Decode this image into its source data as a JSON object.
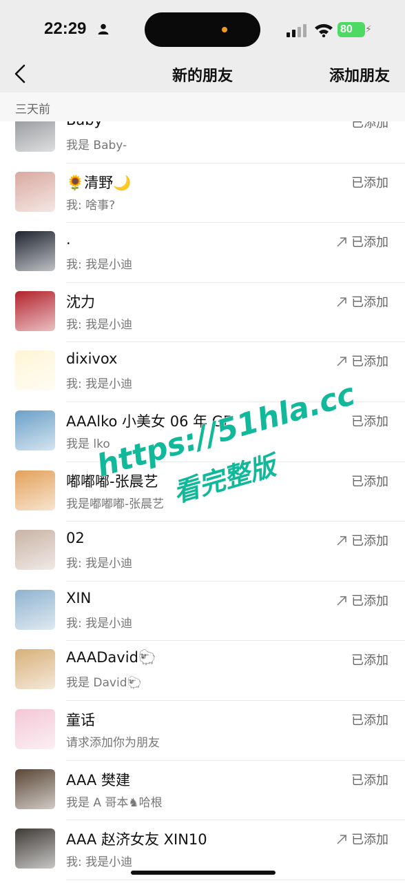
{
  "status_bar": {
    "time": "22:29",
    "battery": "80",
    "icons": [
      "person-icon",
      "signal-icon",
      "wifi-icon",
      "battery-icon"
    ],
    "battery_color": "#4cd964",
    "island_dot_color": "#f39a1e"
  },
  "nav": {
    "back_icon": "chevron-left-icon",
    "title": "新的朋友",
    "add_friend": "添加朋友"
  },
  "section": {
    "label": "三天前"
  },
  "rows": [
    {
      "name": "Baby-",
      "sub": "我是 Baby-",
      "status": "已添加",
      "arrow": false,
      "avatar_color": "#8c8f93"
    },
    {
      "name": "🌻清野🌙",
      "sub": "我: 啥事?",
      "status": "已添加",
      "arrow": false,
      "avatar_color": "#d9a9a0"
    },
    {
      "name": ".",
      "sub": "我: 我是小迪",
      "status": "已添加",
      "arrow": true,
      "avatar_color": "#1f2430"
    },
    {
      "name": "沈力",
      "sub": "我: 我是小迪",
      "status": "已添加",
      "arrow": true,
      "avatar_color": "#b3222c"
    },
    {
      "name": "dixivox",
      "sub": "我: 我是小迪",
      "status": "已添加",
      "arrow": true,
      "avatar_color": "#fff5d6"
    },
    {
      "name": "AAAlko 小美女 06 年 GF",
      "sub": "我是 lko",
      "status": "已添加",
      "arrow": false,
      "avatar_color": "#6aa0c8"
    },
    {
      "name": "嘟嘟嘟-张晨艺",
      "sub": "我是嘟嘟嘟-张晨艺",
      "status": "已添加",
      "arrow": false,
      "avatar_color": "#e3a15a"
    },
    {
      "name": "02",
      "sub": "我: 我是小迪",
      "status": "已添加",
      "arrow": true,
      "avatar_color": "#c9b3a6"
    },
    {
      "name": "XIN",
      "sub": "我: 我是小迪",
      "status": "已添加",
      "arrow": true,
      "avatar_color": "#8fb3cf"
    },
    {
      "name": "AAADavid🐑",
      "sub": "我是 David🐑",
      "status": "已添加",
      "arrow": false,
      "avatar_color": "#d8b07a"
    },
    {
      "name": "童话",
      "sub": "请求添加你为朋友",
      "status": "已添加",
      "arrow": false,
      "avatar_color": "#f3c7d6"
    },
    {
      "name": "AAA 樊建",
      "sub": "我是 A 哥本♞哈根",
      "status": "已添加",
      "arrow": false,
      "avatar_color": "#5a4636"
    },
    {
      "name": "AAA 赵济女友 XIN10",
      "sub": "我: 我是小迪",
      "status": "已添加",
      "arrow": true,
      "avatar_color": "#3e3a36"
    }
  ],
  "watermark": {
    "line1": "https://51hla.cc",
    "line2": "看完整版",
    "color": "#11b89a"
  }
}
